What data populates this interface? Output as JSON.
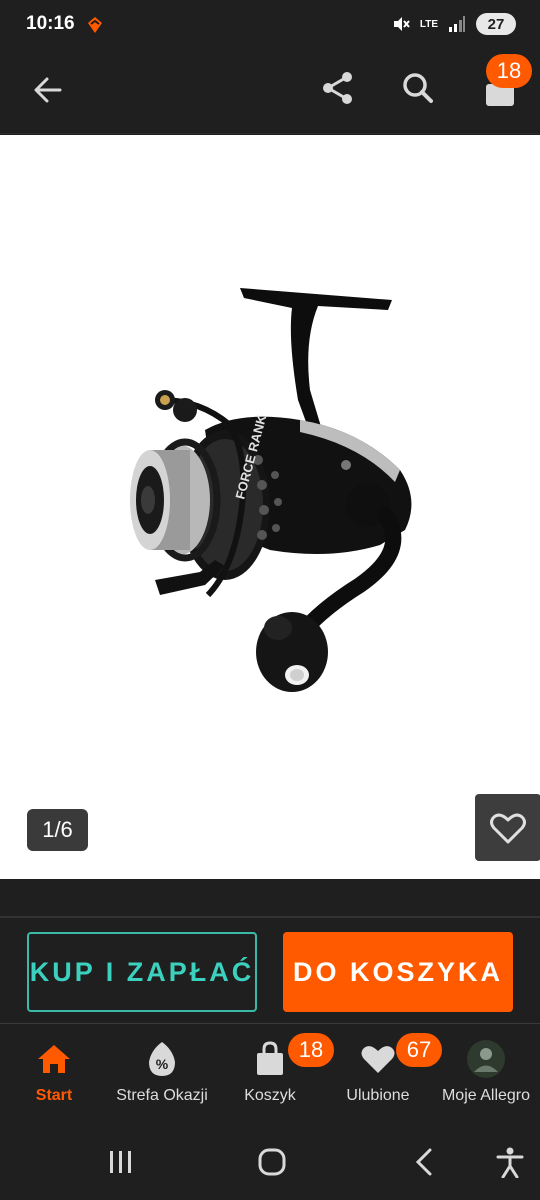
{
  "status_bar": {
    "time": "10:16",
    "network": "LTE",
    "battery": "27"
  },
  "header": {
    "icons": [
      "back-arrow-icon",
      "share-icon",
      "search-icon",
      "cart-icon"
    ],
    "cart_count": "18"
  },
  "gallery": {
    "counter": "1/6",
    "product_brand_text": "FORCE RANK"
  },
  "actions": {
    "buy_now_label": "KUP I ZAPŁAĆ",
    "add_to_cart_label": "DO KOSZYKA"
  },
  "bottom_nav": {
    "items": [
      {
        "label": "Start",
        "icon": "home-icon",
        "active": true
      },
      {
        "label": "Strefa Okazji",
        "icon": "deals-percent-icon"
      },
      {
        "label": "Koszyk",
        "icon": "shopping-bag-icon",
        "badge": "18"
      },
      {
        "label": "Ulubione",
        "icon": "heart-icon",
        "badge": "67"
      },
      {
        "label": "Moje Allegro",
        "icon": "avatar-icon"
      }
    ]
  },
  "colors": {
    "accent_orange": "#ff5a00",
    "teal": "#3bb9a8",
    "background": "#1f1f1f"
  }
}
